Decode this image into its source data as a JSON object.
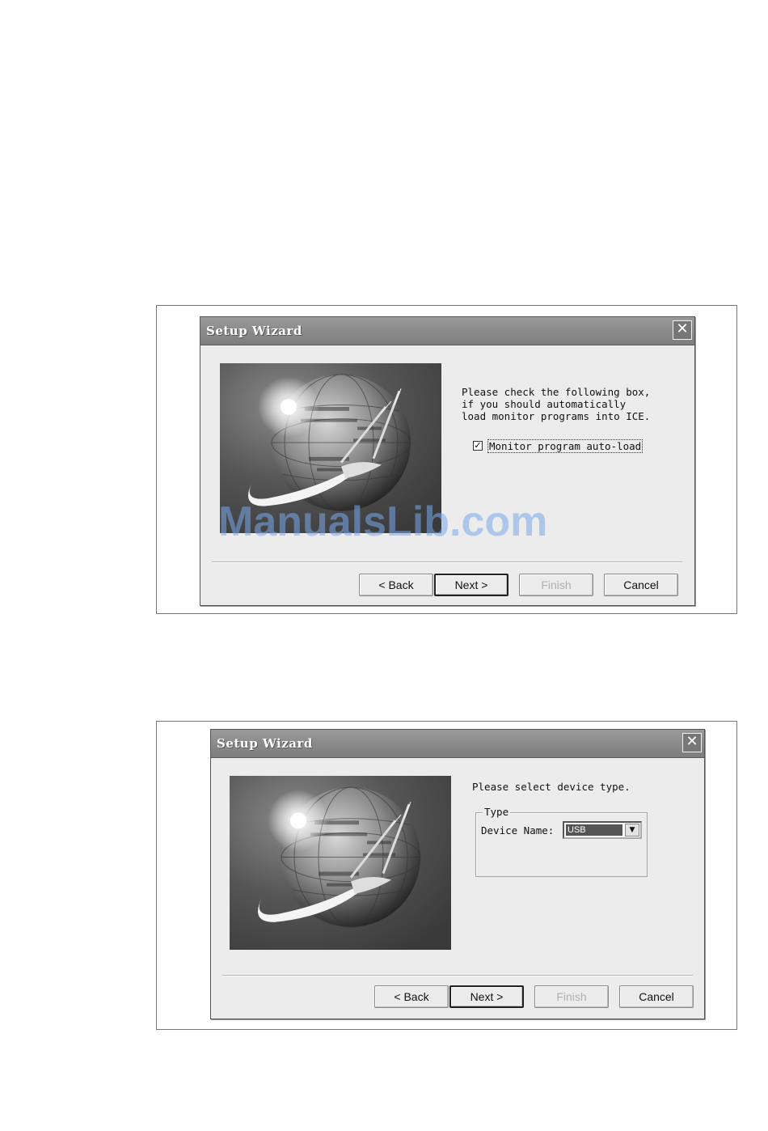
{
  "watermark": "ManualsLib.com",
  "dialogs": [
    {
      "title": "Setup Wizard",
      "close_glyph": "✕",
      "instruction_lines": [
        "Please check the following box,",
        "if you should automatically",
        "load monitor programs into ICE."
      ],
      "checkbox": {
        "label": "Monitor program auto-load",
        "checked": true,
        "check_glyph": "✓"
      },
      "buttons": {
        "back": "< Back",
        "next": "Next >",
        "finish": "Finish",
        "cancel": "Cancel"
      }
    },
    {
      "title": "Setup Wizard",
      "close_glyph": "✕",
      "instruction": "Please select device type.",
      "group": {
        "legend": "Type",
        "field_label": "Device Name:",
        "selected_value": "USB",
        "arrow_glyph": "▼"
      },
      "buttons": {
        "back": "< Back",
        "next": "Next >",
        "finish": "Finish",
        "cancel": "Cancel"
      }
    }
  ]
}
